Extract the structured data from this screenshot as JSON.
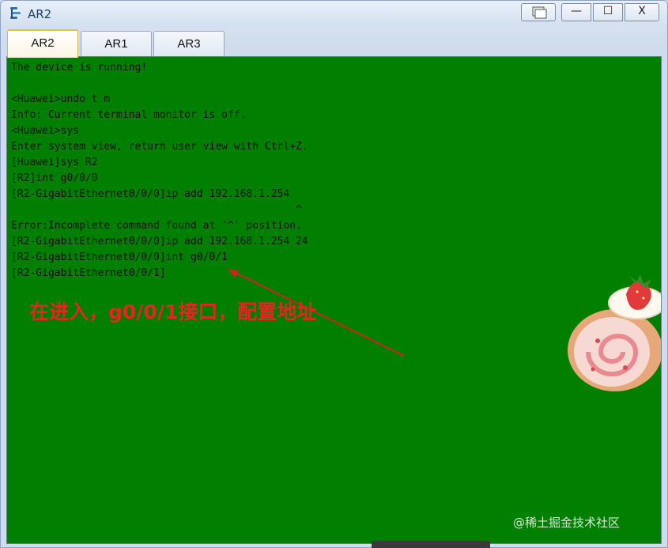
{
  "window": {
    "title": "AR2",
    "controls": {
      "minimize": "—",
      "maximize": "☐",
      "close": "X"
    }
  },
  "tabs": [
    {
      "label": "AR2",
      "active": true
    },
    {
      "label": "AR1",
      "active": false
    },
    {
      "label": "AR3",
      "active": false
    }
  ],
  "terminal": {
    "background": "#007f00",
    "text_color": "#101010",
    "lines": [
      "The device is running!",
      "",
      "<Huawei>undo t m",
      "Info: Current terminal monitor is off.",
      "<Huawei>sys",
      "Enter system view, return user view with Ctrl+Z.",
      "[Huawei]sys R2",
      "[R2]int g0/0/0",
      "[R2-GigabitEthernet0/0/0]ip add 192.168.1.254",
      "                                              ^",
      "Error:Incomplete command found at '^' position.",
      "[R2-GigabitEthernet0/0/0]ip add 192.168.1.254 24",
      "[R2-GigabitEthernet0/0/0]int g0/0/1",
      "[R2-GigabitEthernet0/0/1]"
    ]
  },
  "annotation": {
    "text": "在进入，g0/0/1接口，配置地址",
    "color": "#e62424"
  },
  "watermark": "@稀土掘金技术社区"
}
